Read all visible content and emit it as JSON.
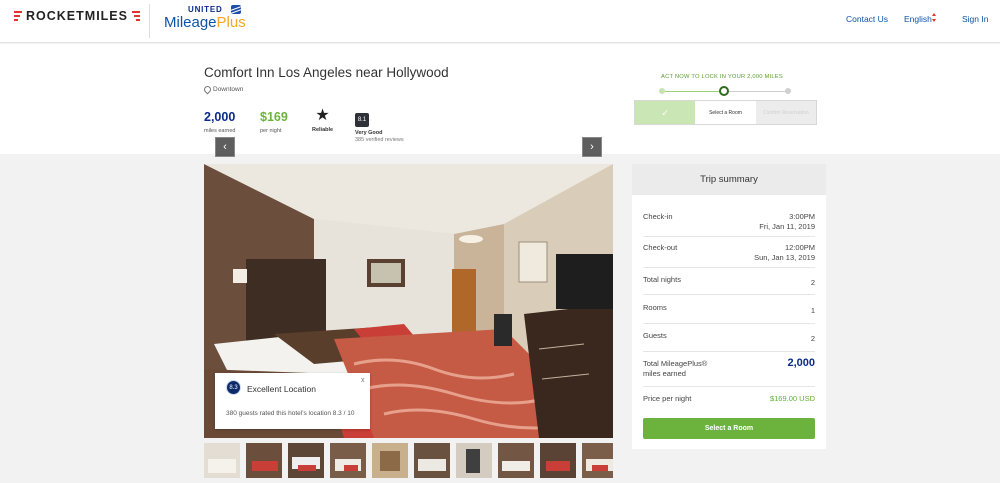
{
  "header": {
    "brand": "ROCKETMILES",
    "partner_top": "UNITED",
    "partner_name": "Mileage",
    "partner_name_accent": "Plus",
    "nav": {
      "contact": "Contact Us",
      "language": "English",
      "signin": "Sign In"
    }
  },
  "hotel": {
    "name": "Comfort Inn Los Angeles near Hollywood",
    "location": "Downtown",
    "miles": {
      "value": "2,000",
      "label": "miles earned"
    },
    "price": {
      "value": "$169",
      "label": "per night"
    },
    "reliable": {
      "label": "Reliable"
    },
    "rating": {
      "score": "8.1",
      "word": "Very Good",
      "reviews": "385 verified reviews"
    }
  },
  "progress": {
    "headline": "ACT NOW TO LOCK IN YOUR 2,000 MILES",
    "steps": [
      "✓",
      "Select a Room",
      "Confirm Reservation"
    ]
  },
  "gallery": {
    "location_card": {
      "score": "8.3",
      "title": "Excellent Location",
      "close": "x",
      "description": "380 guests rated this hotel's location 8.3 / 10"
    },
    "prev": "‹",
    "next": "›"
  },
  "summary": {
    "title": "Trip summary",
    "rows": [
      {
        "label": "Check-in",
        "value_line1": "3:00PM",
        "value_line2": "Fri, Jan 11, 2019"
      },
      {
        "label": "Check-out",
        "value_line1": "12:00PM",
        "value_line2": "Sun, Jan 13, 2019"
      },
      {
        "label": "Total nights",
        "value_line1": "2"
      },
      {
        "label": "Rooms",
        "value_line1": "1"
      },
      {
        "label": "Guests",
        "value_line1": "2"
      },
      {
        "label": "Total MileagePlus® miles earned",
        "value_line1": "2,000"
      },
      {
        "label": "Price per night",
        "value_line1": "$169.00 USD"
      }
    ],
    "button": "Select a Room"
  },
  "colors": {
    "brand_red": "#e5322d",
    "united_blue": "#0b2a8a",
    "green": "#6cb33e"
  }
}
